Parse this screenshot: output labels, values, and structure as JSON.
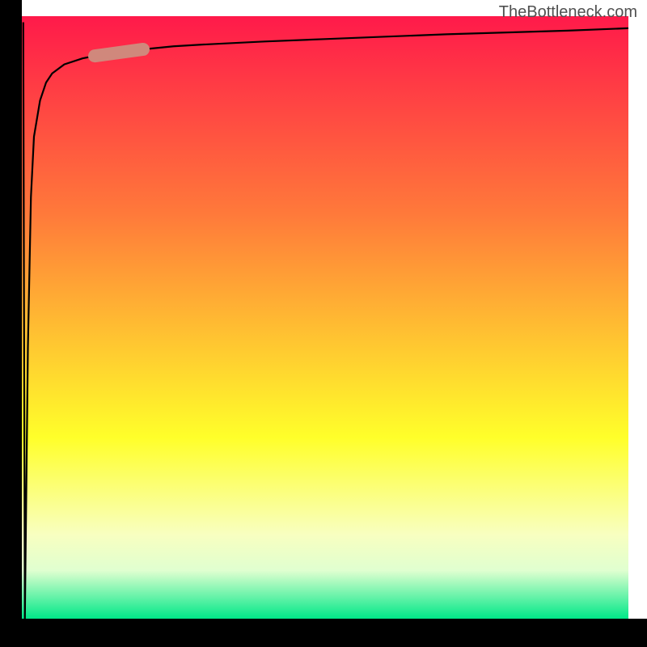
{
  "watermark": "TheBottleneck.com",
  "chart_data": {
    "type": "line",
    "title": "",
    "xlabel": "",
    "ylabel": "",
    "xlim": [
      0,
      100
    ],
    "ylim": [
      0,
      100
    ],
    "x": [
      0.5,
      1,
      1.5,
      2,
      3,
      4,
      5,
      7,
      10,
      15,
      20,
      25,
      30,
      40,
      50,
      60,
      70,
      80,
      90,
      100
    ],
    "values": [
      0,
      45,
      70,
      80,
      86,
      89,
      90.5,
      92,
      93,
      94,
      94.5,
      95,
      95.3,
      95.8,
      96.2,
      96.6,
      97.0,
      97.3,
      97.6,
      98
    ],
    "gradient_colors": {
      "top": "#ff1a4a",
      "mid_upper": "#ff7a3a",
      "mid_lower": "#ffff2a",
      "bottom": "#00e888"
    },
    "highlight_region": {
      "x_start": 12,
      "x_end": 20,
      "color": "#d0887c"
    },
    "axis_stroke": "#000000"
  }
}
